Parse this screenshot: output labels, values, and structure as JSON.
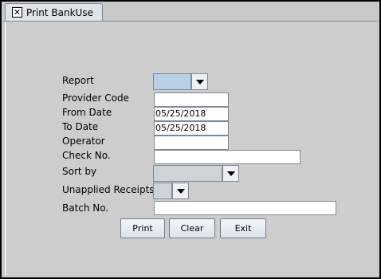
{
  "window": {
    "tab_title": "Print BankUse",
    "close_glyph": "✕"
  },
  "form": {
    "report_label": "Report",
    "provider_code_label": "Provider Code",
    "provider_code_value": "",
    "from_date_label": "From Date",
    "from_date_value": "05/25/2018",
    "to_date_label": "To Date",
    "to_date_value": "05/25/2018",
    "operator_label": "Operator",
    "operator_value": "",
    "check_no_label": "Check No.",
    "check_no_value": "",
    "sort_by_label": "Sort by",
    "unapplied_receipts_label": "Unapplied Receipts",
    "batch_no_label": "Batch No.",
    "batch_no_value": ""
  },
  "buttons": {
    "print_mnemonic": "P",
    "print_rest": "rint",
    "clear_first": "C",
    "clear_mnemonic": "l",
    "clear_rest": "ear",
    "exit_first": "E",
    "exit_mnemonic": "x",
    "exit_rest": "it"
  },
  "colors": {
    "combo_selected": "#b8cfe5",
    "panel": "#cdcdcd"
  }
}
